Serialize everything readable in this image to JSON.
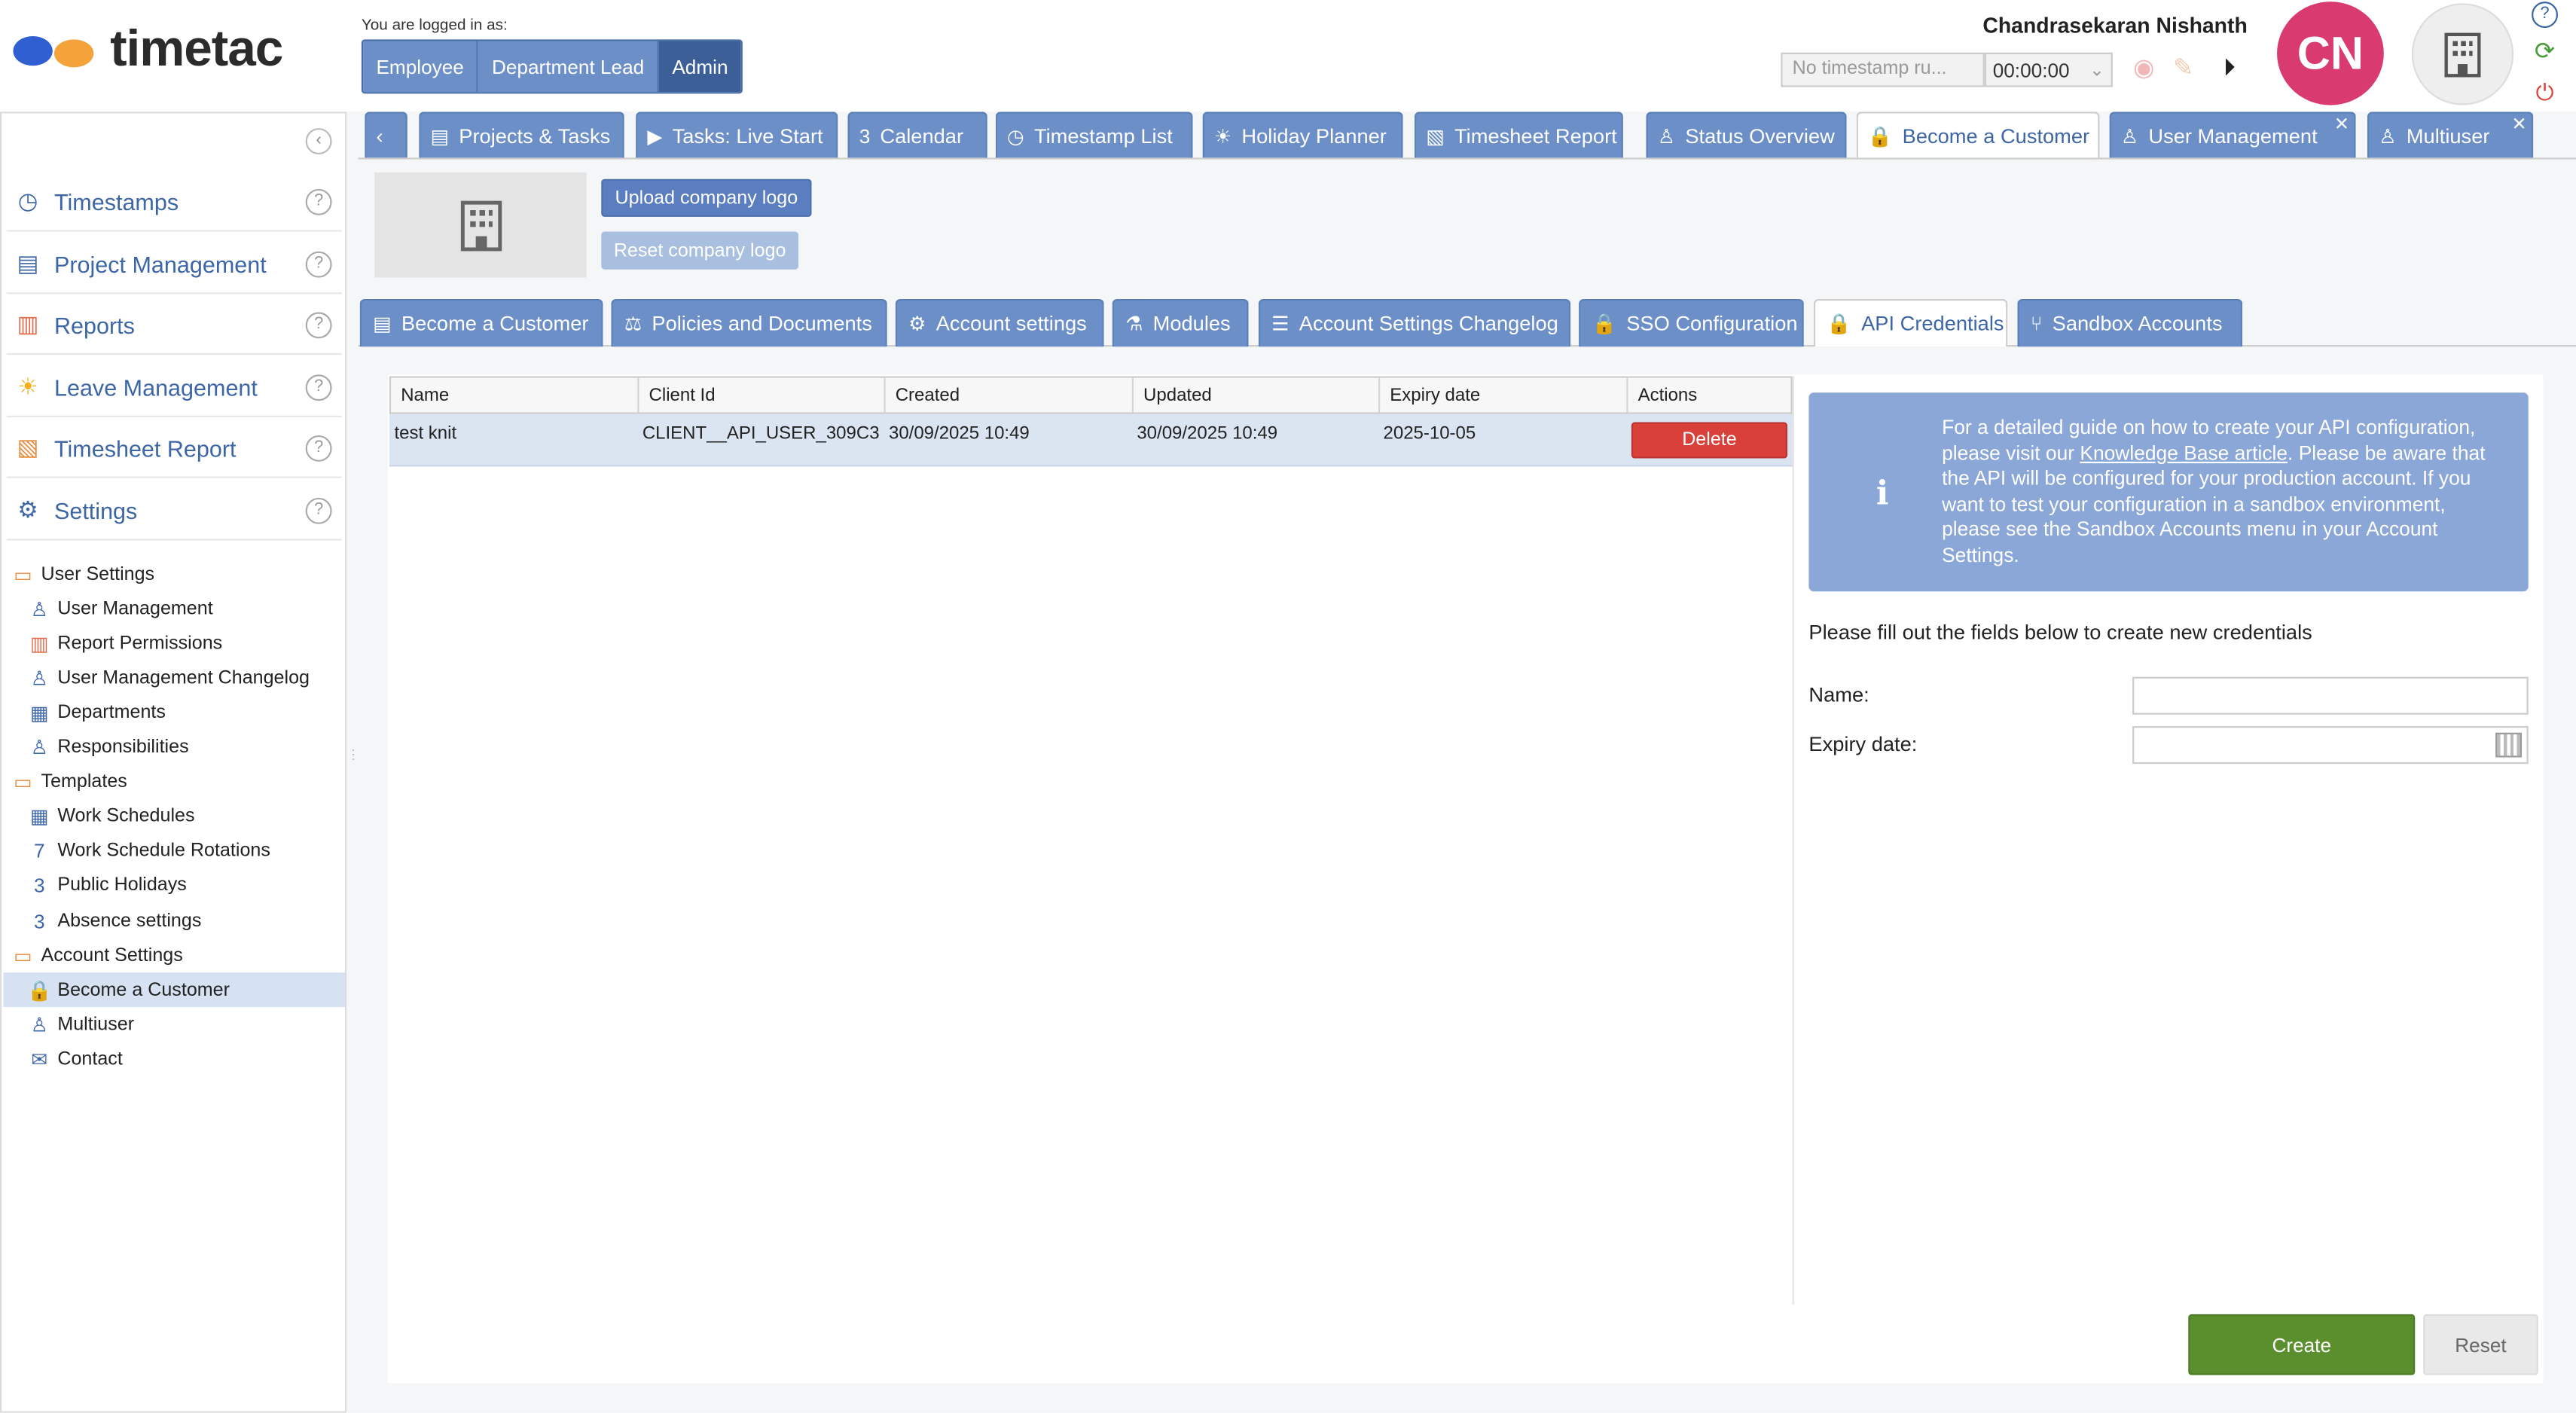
{
  "brand": {
    "name": "timetac",
    "colors": {
      "dot1": "#2f5fd0",
      "dot2": "#f4a23a"
    }
  },
  "header": {
    "logged_in_label": "You are logged in as:",
    "roles": [
      "Employee",
      "Department Lead",
      "Admin"
    ],
    "active_role": "Admin",
    "user_name": "Chandrasekaran Nishanth",
    "timestamp_placeholder": "No timestamp ru...",
    "timer": "00:00:00",
    "avatar_initials": "CN",
    "avatar_color": "#d93a6f"
  },
  "sidebar": {
    "modules": [
      {
        "label": "Timestamps",
        "icon": "clock-icon"
      },
      {
        "label": "Project Management",
        "icon": "clipboard-icon"
      },
      {
        "label": "Reports",
        "icon": "bar-chart-icon"
      },
      {
        "label": "Leave Management",
        "icon": "sun-icon"
      },
      {
        "label": "Timesheet Report",
        "icon": "timesheet-icon"
      },
      {
        "label": "Settings",
        "icon": "gear-icon"
      }
    ],
    "tree": [
      {
        "label": "User Settings",
        "level": 0,
        "icon": "folder-icon"
      },
      {
        "label": "User Management",
        "level": 1,
        "icon": "user-icon"
      },
      {
        "label": "Report Permissions",
        "level": 1,
        "icon": "bar-chart-icon"
      },
      {
        "label": "User Management Changelog",
        "level": 1,
        "icon": "user-search-icon"
      },
      {
        "label": "Departments",
        "level": 1,
        "icon": "departments-icon"
      },
      {
        "label": "Responsibilities",
        "level": 1,
        "icon": "user-icon"
      },
      {
        "label": "Templates",
        "level": 0,
        "icon": "folder-icon"
      },
      {
        "label": "Work Schedules",
        "level": 1,
        "icon": "calendar-icon"
      },
      {
        "label": "Work Schedule Rotations",
        "level": 1,
        "icon": "calendar-7-icon"
      },
      {
        "label": "Public Holidays",
        "level": 1,
        "icon": "calendar-3-icon"
      },
      {
        "label": "Absence settings",
        "level": 1,
        "icon": "calendar-3-icon"
      },
      {
        "label": "Account Settings",
        "level": 0,
        "icon": "folder-icon"
      },
      {
        "label": "Become a Customer",
        "level": 1,
        "icon": "lock-icon",
        "selected": true
      },
      {
        "label": "Multiuser",
        "level": 1,
        "icon": "multiuser-icon"
      },
      {
        "label": "Contact",
        "level": 1,
        "icon": "envelope-icon"
      }
    ]
  },
  "top_tabs": [
    {
      "label": "Projects & Tasks",
      "icon": "clipboard-icon"
    },
    {
      "label": "Tasks: Live Start",
      "icon": "play-icon"
    },
    {
      "label": "Calendar",
      "icon": "calendar-3-icon"
    },
    {
      "label": "Timestamp List",
      "icon": "clock-icon"
    },
    {
      "label": "Holiday Planner",
      "icon": "sun-icon"
    },
    {
      "label": "Timesheet Report",
      "icon": "timesheet-icon"
    },
    {
      "label": "Status Overview",
      "icon": "user-status-icon"
    },
    {
      "label": "Become a Customer",
      "icon": "lock-icon",
      "active": true
    },
    {
      "label": "User Management",
      "icon": "user-icon",
      "closable": true
    },
    {
      "label": "Multiuser",
      "icon": "multiuser-icon",
      "closable": true
    }
  ],
  "company_logo": {
    "upload_label": "Upload company logo",
    "reset_label": "Reset company logo"
  },
  "sub_tabs": [
    {
      "label": "Become a Customer",
      "icon": "form-icon"
    },
    {
      "label": "Policies and Documents",
      "icon": "scale-icon"
    },
    {
      "label": "Account settings",
      "icon": "gears-icon"
    },
    {
      "label": "Modules",
      "icon": "flask-icon"
    },
    {
      "label": "Account Settings Changelog",
      "icon": "list-icon"
    },
    {
      "label": "SSO Configuration",
      "icon": "lock-icon"
    },
    {
      "label": "API Credentials",
      "icon": "lock-icon",
      "active": true
    },
    {
      "label": "Sandbox Accounts",
      "icon": "branch-icon"
    }
  ],
  "grid": {
    "columns": [
      "Name",
      "Client Id",
      "Created",
      "Updated",
      "Expiry date",
      "Actions"
    ],
    "rows": [
      {
        "name": "test knit",
        "client_id": "CLIENT__API_USER_309C3",
        "created": "30/09/2025 10:49",
        "updated": "30/09/2025 10:49",
        "expiry": "2025-10-05",
        "action": "Delete"
      }
    ]
  },
  "info": {
    "text_before": "For a detailed guide on how to create your API configuration, please visit our ",
    "link": "Knowledge Base article",
    "text_after": ". Please be aware that the API will be configured for your production account. If you want to test your configuration in a sandbox environment, please see the Sandbox Accounts menu in your Account Settings."
  },
  "form": {
    "intro": "Please fill out the fields below to create new credentials",
    "name_label": "Name:",
    "name_value": "",
    "expiry_label": "Expiry date:",
    "expiry_value": "",
    "create_label": "Create",
    "reset_label": "Reset"
  }
}
